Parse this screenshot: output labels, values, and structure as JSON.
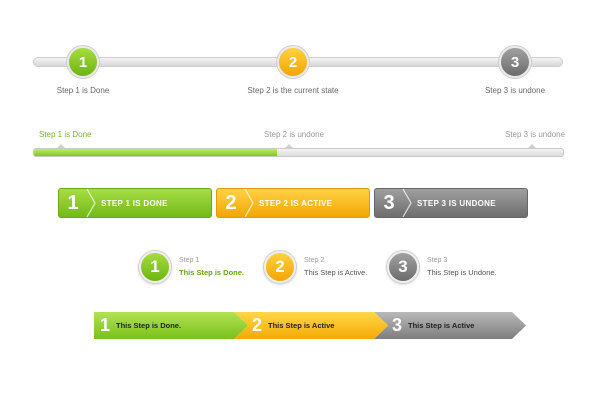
{
  "row1": {
    "steps": [
      {
        "number": "1",
        "label": "Step 1 is Done",
        "status": "done"
      },
      {
        "number": "2",
        "label": "Step 2 is the current state",
        "status": "active"
      },
      {
        "number": "3",
        "label": "Step 3 is undone",
        "status": "undone"
      }
    ]
  },
  "row2": {
    "labels": [
      "Step 1 is Done",
      "Step 2 is undone",
      "Step 3 is undone"
    ],
    "progress": 0.46
  },
  "row3": {
    "buttons": [
      {
        "number": "1",
        "label": "STEP 1 IS DONE"
      },
      {
        "number": "2",
        "label": "STEP 2 IS ACTIVE"
      },
      {
        "number": "3",
        "label": "STEP 3 IS UNDONE"
      }
    ]
  },
  "row4": {
    "items": [
      {
        "number": "1",
        "step": "Step 1",
        "desc": "This Step is Done."
      },
      {
        "number": "2",
        "step": "Step 2",
        "desc": "This Step is Active."
      },
      {
        "number": "3",
        "step": "Step 3",
        "desc": "This Step is Undone."
      }
    ]
  },
  "row5": {
    "segments": [
      {
        "number": "1",
        "label": "This Step is Done."
      },
      {
        "number": "2",
        "label": "This Step is Active"
      },
      {
        "number": "3",
        "label": "This Step is Active"
      }
    ]
  },
  "colors": {
    "done": "#7ec81c",
    "active": "#f7b80f",
    "undone": "#8a8a8a"
  }
}
